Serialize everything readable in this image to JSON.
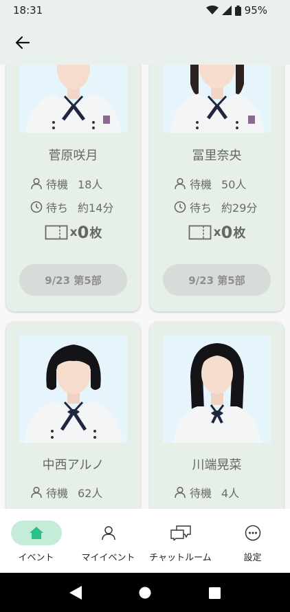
{
  "status_bar": {
    "time": "18:31",
    "battery": "95%"
  },
  "app_bar": {
    "back_icon": "arrow-left-icon"
  },
  "members": [
    {
      "name": "菅原咲月",
      "waiting_label": "待機",
      "waiting_count": "18人",
      "wait_time_label": "待ち",
      "wait_time": "約14分",
      "ticket_x": "x",
      "ticket_count": "0",
      "ticket_unit": "枚",
      "session": "9/23 第5部"
    },
    {
      "name": "冨里奈央",
      "waiting_label": "待機",
      "waiting_count": "50人",
      "wait_time_label": "待ち",
      "wait_time": "約29分",
      "ticket_x": "x",
      "ticket_count": "0",
      "ticket_unit": "枚",
      "session": "9/23 第5部"
    },
    {
      "name": "中西アルノ",
      "waiting_label": "待機",
      "waiting_count": "62人"
    },
    {
      "name": "川端晃菜",
      "waiting_label": "待機",
      "waiting_count": "4人"
    }
  ],
  "bottom_nav": [
    {
      "label": "イベント",
      "icon": "home-icon",
      "active": true
    },
    {
      "label": "マイイベント",
      "icon": "person-icon",
      "active": false
    },
    {
      "label": "チャットルーム",
      "icon": "chat-icon",
      "active": false
    },
    {
      "label": "設定",
      "icon": "more-icon",
      "active": false
    }
  ],
  "colors": {
    "accent": "#2fbf88",
    "nav_active_bg": "#c4ecd9",
    "card_bg": "#e7efe9",
    "button_bg": "#d8dcd9"
  }
}
